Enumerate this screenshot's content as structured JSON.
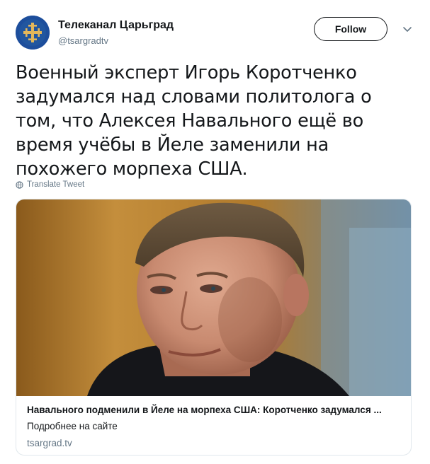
{
  "author": {
    "display_name": "Телеканал Царьград",
    "handle": "@tsargradtv",
    "avatar_icon": "orthodox-cross-logo",
    "avatar_color": "#1d4e9c"
  },
  "actions": {
    "follow_label": "Follow",
    "menu_icon": "chevron-down-icon"
  },
  "tweet": {
    "text": "Военный эксперт Игорь Коротченко задумался над словами политолога о том, что Алексея Навального ещё во время учёбы в Йеле заменили на похожего морпеха США.",
    "translate_label": "Translate Tweet"
  },
  "card": {
    "title": "Навального подменили в Йеле на морпеха США: Коротченко задумался ...",
    "description": "Подробнее на сайте",
    "domain": "tsargrad.tv"
  },
  "colors": {
    "text": "#14171a",
    "secondary": "#657786",
    "border": "#e1e8ed",
    "brand": "#1d4e9c"
  }
}
